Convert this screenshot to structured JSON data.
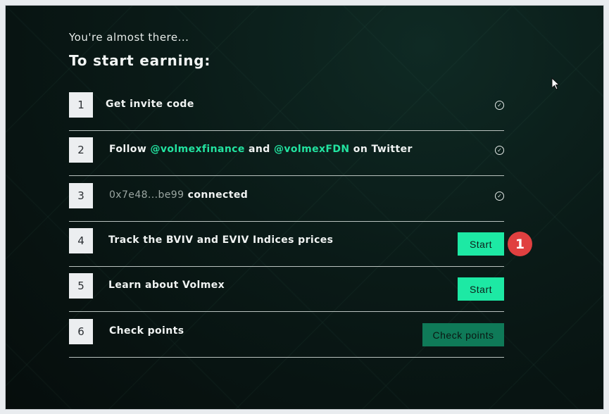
{
  "header": {
    "pre": "You're almost there...",
    "title": "To start earning:"
  },
  "steps": [
    {
      "number": "1",
      "label": "Get invite code",
      "status": "done"
    },
    {
      "number": "2",
      "label_parts": [
        "Follow ",
        "@volmexfinance",
        " and ",
        "@volmexFDN",
        " on Twitter"
      ],
      "status": "done"
    },
    {
      "number": "3",
      "address": "0x7e48...be99",
      "label": " connected",
      "status": "done"
    },
    {
      "number": "4",
      "label": "Track the BVIV and EVIV Indices prices",
      "button": "Start"
    },
    {
      "number": "5",
      "label": "Learn about Volmex",
      "button": "Start"
    },
    {
      "number": "6",
      "label": "Check points",
      "button": "Check points"
    }
  ],
  "annotation": {
    "badge": "1",
    "color": "#e04040"
  },
  "colors": {
    "accent": "#1de9a4",
    "link": "#22e3a0",
    "accent_dark": "#0f7a58"
  }
}
